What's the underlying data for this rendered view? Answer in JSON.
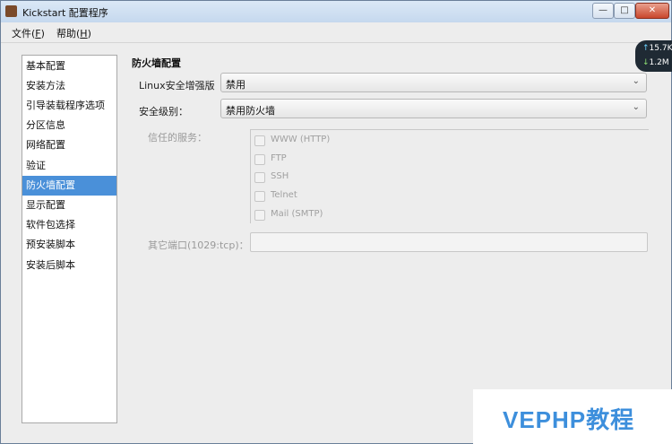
{
  "window": {
    "title": "Kickstart 配置程序",
    "buttons": {
      "minimize": "—",
      "maximize": "□",
      "close": "✕"
    }
  },
  "menu": {
    "file": {
      "label": "文件(",
      "key": "F",
      "suffix": ")"
    },
    "help": {
      "label": "帮助(",
      "key": "H",
      "suffix": ")"
    }
  },
  "sidebar": {
    "selected_index": 6,
    "items": [
      {
        "label": "基本配置"
      },
      {
        "label": "安装方法"
      },
      {
        "label": "引导装载程序选项"
      },
      {
        "label": "分区信息"
      },
      {
        "label": "网络配置"
      },
      {
        "label": "验证"
      },
      {
        "label": "防火墙配置"
      },
      {
        "label": "显示配置"
      },
      {
        "label": "软件包选择"
      },
      {
        "label": "预安装脚本"
      },
      {
        "label": "安装后脚本"
      }
    ]
  },
  "main": {
    "section_title": "防火墙配置",
    "selinux": {
      "label": "Linux安全增强版",
      "value": "禁用"
    },
    "security_level": {
      "label": "安全级别：",
      "value": "禁用防火墙"
    },
    "trusted_services": {
      "label": "信任的服务：",
      "items": [
        "WWW (HTTP)",
        "FTP",
        "SSH",
        "Telnet",
        "Mail (SMTP)"
      ]
    },
    "other_ports": {
      "label": "其它端口(1029:tcp)：",
      "value": ""
    }
  },
  "network_widget": {
    "up_arrow": "↑",
    "up": "15.7K",
    "down_arrow": "↓",
    "down": "1.2M"
  },
  "watermark": {
    "text": "VEPHP教程"
  },
  "colors": {
    "selection": "#4a90d9",
    "watermark": "#3d8fdc",
    "titlebar": "#c5d8ee"
  }
}
